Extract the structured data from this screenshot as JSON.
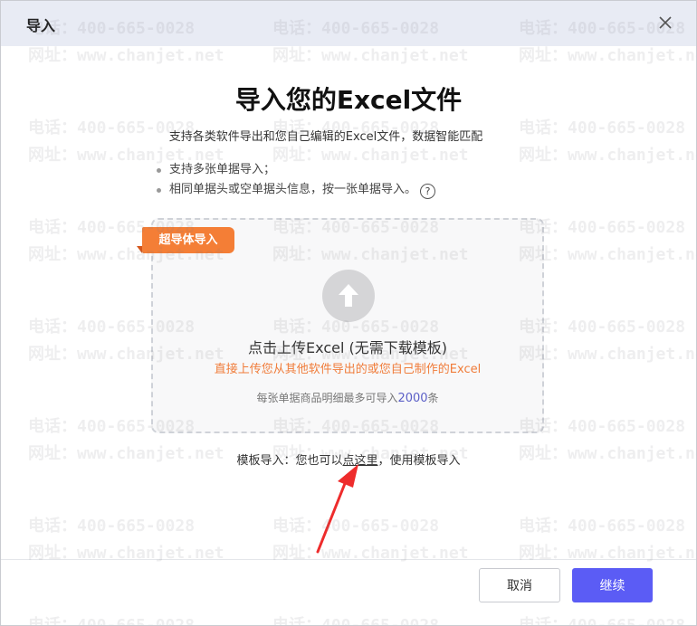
{
  "header": {
    "title": "导入"
  },
  "main": {
    "title": "导入您的Excel文件",
    "subtitle": "支持各类软件导出和您自己编辑的Excel文件，数据智能匹配",
    "bullets": [
      "支持多张单据导入；",
      "相同单据头或空单据头信息，按一张单据导入。"
    ],
    "help_icon": "?"
  },
  "dropzone": {
    "tag": "超导体导入",
    "title": "点击上传Excel (无需下载模板)",
    "hint": "直接上传您从其他软件导出的或您自己制作的Excel",
    "limit_prefix": "每张单据商品明细最多可导入",
    "limit_number": "2000",
    "limit_suffix": "条"
  },
  "template": {
    "prefix": "模板导入：您也可以",
    "link": "点这里",
    "suffix": "，使用模板导入"
  },
  "footer": {
    "cancel": "取消",
    "continue": "继续"
  },
  "watermark": {
    "phone": "电话：400-665-0028",
    "site": "网址：www.chanjet.net"
  },
  "colors": {
    "primary": "#5b5cf5",
    "accent": "#f47e36",
    "header_bg": "#e8ebf4"
  },
  "icons": {
    "close": "close-icon",
    "upload": "upload-arrow-icon",
    "help": "help-icon"
  }
}
